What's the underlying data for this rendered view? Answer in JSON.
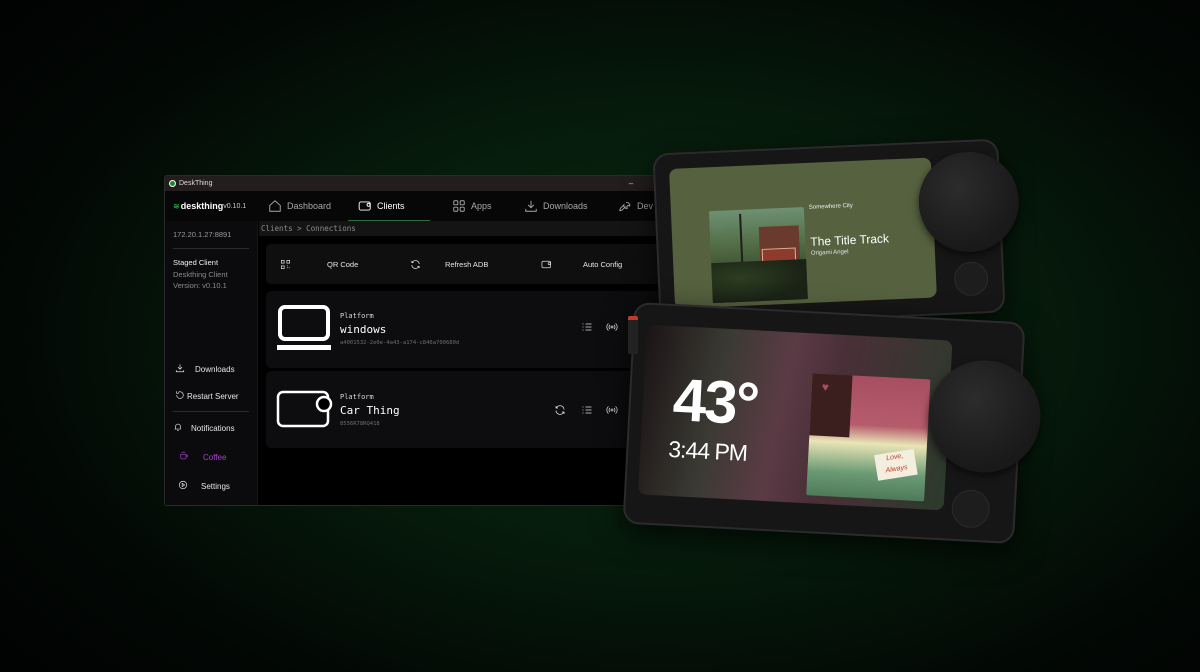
{
  "window": {
    "title": "DeskThing",
    "minimize_glyph": "–",
    "maximize_glyph": "▢"
  },
  "brand": {
    "name": "deskthing",
    "version": "v0.10.1"
  },
  "nav": {
    "tabs": [
      {
        "label": "Dashboard",
        "icon": "home-icon",
        "active": false
      },
      {
        "label": "Clients",
        "icon": "device-icon",
        "active": true
      },
      {
        "label": "Apps",
        "icon": "grid-icon",
        "active": false
      },
      {
        "label": "Downloads",
        "icon": "download-icon",
        "active": false
      },
      {
        "label": "Dev",
        "icon": "wrench-icon",
        "active": false
      }
    ]
  },
  "sidebar": {
    "ip": "172.20.1.27:8891",
    "staged": {
      "title": "Staged Client",
      "subtitle": "Deskthing Client",
      "version": "Version: v0.10.1"
    },
    "items": [
      {
        "label": "Downloads",
        "icon": "download-icon"
      },
      {
        "label": "Restart Server",
        "icon": "restart-icon"
      },
      {
        "label": "Notifications",
        "icon": "bell-icon"
      },
      {
        "label": "Coffee",
        "icon": "coffee-icon"
      },
      {
        "label": "Settings",
        "icon": "settings-icon"
      }
    ],
    "accent_color": "#a144c8"
  },
  "main": {
    "breadcrumb": "Clients > Connections",
    "toolbar": {
      "qr_label": "QR Code",
      "refresh_label": "Refresh ADB",
      "auto_label": "Auto Config"
    },
    "clients": [
      {
        "platform_label": "Platform",
        "platform": "windows",
        "id": "a4001532-2e0e-4a43-a174-c846a700680d"
      },
      {
        "platform_label": "Platform",
        "platform": "Car Thing",
        "id": "8556R78RQ418"
      }
    ]
  },
  "devices": {
    "music": {
      "album": "Somewhere City",
      "title": "The Title Track",
      "artist": "Origami Angel"
    },
    "clock": {
      "temperature": "43°",
      "time": "3:44 PM",
      "note_text": "Love, Always"
    }
  }
}
